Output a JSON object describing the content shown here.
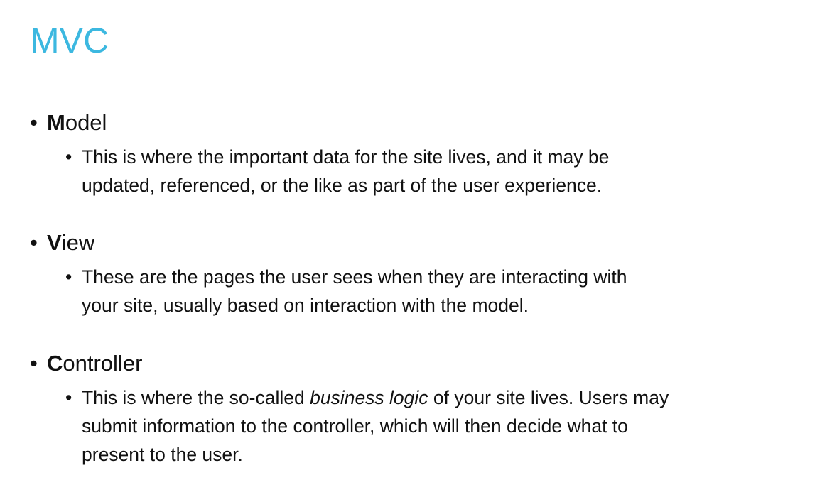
{
  "title": "MVC",
  "colors": {
    "title": "#3cb8e0",
    "text": "#111111"
  },
  "sections": [
    {
      "initial": "M",
      "rest": "odel",
      "lines": [
        [
          "This is where the important data for the site lives, and it may be"
        ],
        [
          "updated, referenced, or the like as part of the user experience."
        ]
      ]
    },
    {
      "initial": "V",
      "rest": "iew",
      "lines": [
        [
          "These are the pages the user sees when they are interacting with"
        ],
        [
          "your site, usually based on interaction with the model."
        ]
      ]
    },
    {
      "initial": "C",
      "rest": "ontroller",
      "lines": [
        [
          "This is where the so-called ",
          "business logic",
          " of your site lives. Users may"
        ],
        [
          "submit information to the controller, which will then decide what to"
        ],
        [
          "present to the user."
        ]
      ]
    }
  ],
  "bullet": "•"
}
